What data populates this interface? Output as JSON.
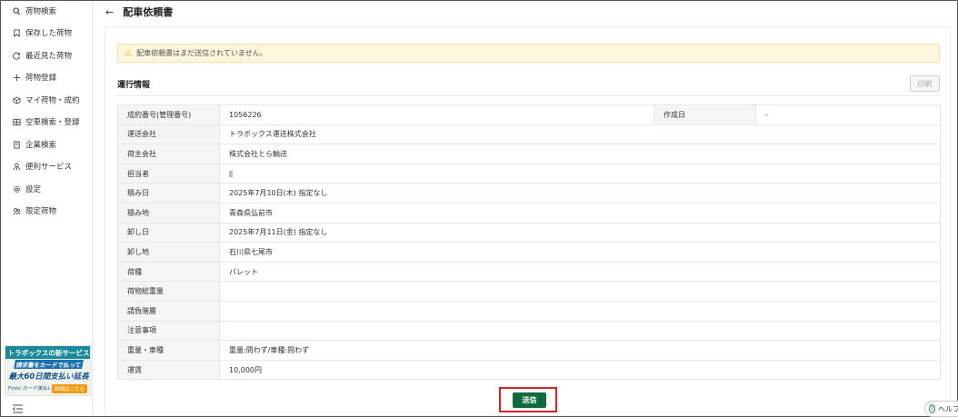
{
  "sidebar": {
    "items": [
      {
        "icon": "search-icon",
        "label": "荷物検索"
      },
      {
        "icon": "bookmark-icon",
        "label": "保存した荷物"
      },
      {
        "icon": "history-icon",
        "label": "最近見た荷物"
      },
      {
        "icon": "plus-icon",
        "label": "荷物登録"
      },
      {
        "icon": "box-icon",
        "label": "マイ荷物・成約"
      },
      {
        "icon": "truck-icon",
        "label": "空車検索・登録"
      },
      {
        "icon": "building-icon",
        "label": "企業検索"
      },
      {
        "icon": "services-icon",
        "label": "便利サービス"
      },
      {
        "icon": "gear-icon",
        "label": "設定"
      },
      {
        "icon": "limited-icon",
        "label": "限定荷物"
      }
    ],
    "banner": {
      "line1": "トラボックスの新サービス",
      "line2": "請求書をカードで払って",
      "line3": "最大60日間支払い延長",
      "line4": "Finto カード後払い",
      "line5": "詳細はこちら"
    }
  },
  "header": {
    "back_label": "←",
    "title": "配車依頼書"
  },
  "alert": {
    "message": "配車依頼書はまだ送信されていません。"
  },
  "section": {
    "title": "運行情報",
    "print_label": "印刷"
  },
  "table": {
    "row0": {
      "label": "成約番号(管理番号)",
      "value": "1056226",
      "label2": "作成日",
      "value2": "-"
    },
    "rows": [
      {
        "label": "運送会社",
        "value": "トラボックス運送株式会社"
      },
      {
        "label": "荷主会社",
        "value": "株式会社とら輸送"
      },
      {
        "label": "担当者",
        "value": ""
      },
      {
        "label": "積み日",
        "value": "2025年7月10日(木) 指定なし"
      },
      {
        "label": "積み地",
        "value": "青森県弘前市"
      },
      {
        "label": "卸し日",
        "value": "2025年7月11日(金) 指定なし"
      },
      {
        "label": "卸し地",
        "value": "石川県七尾市"
      },
      {
        "label": "荷種",
        "value": "パレット"
      },
      {
        "label": "荷物総重量",
        "value": ""
      },
      {
        "label": "請負階層",
        "value": ""
      },
      {
        "label": "注意事項",
        "value": ""
      },
      {
        "label": "重量・車種",
        "value": "重量:問わず/車種:問わず"
      },
      {
        "label": "運賃",
        "value": "10,000円"
      }
    ]
  },
  "submit": {
    "label": "送信"
  },
  "help": {
    "label": "ヘルプ"
  }
}
